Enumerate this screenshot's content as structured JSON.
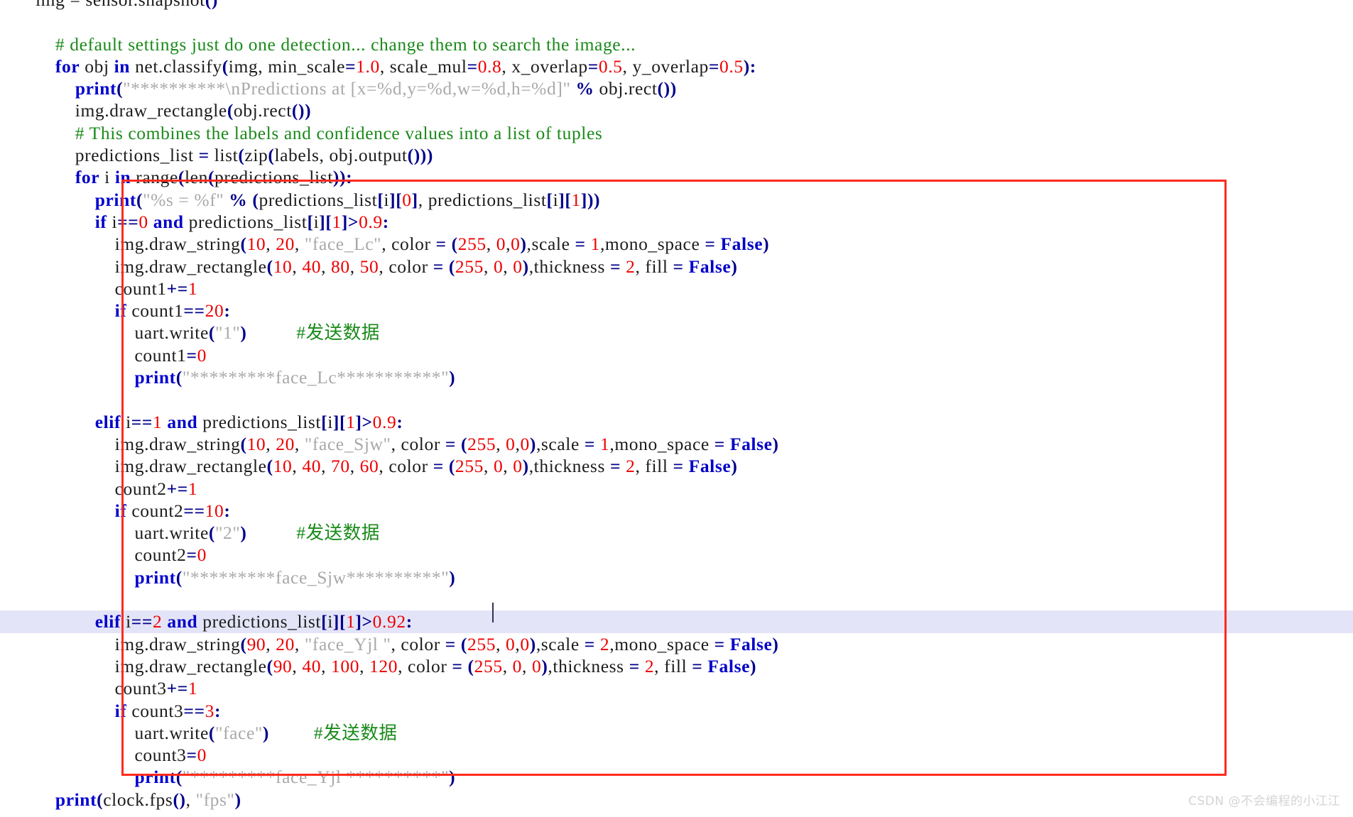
{
  "editor": {
    "language": "python",
    "background_color": "#ffffff",
    "highlight_color": "#e4e4f8",
    "annotation_box_color": "#ff2a1e",
    "caret_visible": true
  },
  "watermark": {
    "text": "CSDN @不会编程的小江江"
  },
  "colors": {
    "keyword": "#0000c8",
    "function": "#0000d2",
    "number": "#ee0000",
    "string": "#a9a9a9",
    "comment": "#1a8a1a",
    "punctuation": "#00008b",
    "plain": "#1c1c1c"
  },
  "code": {
    "lines": [
      {
        "id": 1,
        "highlight": false,
        "text": "img = sensor.snapshot()"
      },
      {
        "id": 2,
        "highlight": false,
        "text": ""
      },
      {
        "id": 3,
        "highlight": false,
        "text": "    # default settings just do one detection... change them to search the image..."
      },
      {
        "id": 4,
        "highlight": false,
        "text": "    for obj in net.classify(img, min_scale=1.0, scale_mul=0.8, x_overlap=0.5, y_overlap=0.5):"
      },
      {
        "id": 5,
        "highlight": false,
        "text": "        print(\"**********\\nPredictions at [x=%d,y=%d,w=%d,h=%d]\" % obj.rect())"
      },
      {
        "id": 6,
        "highlight": false,
        "text": "        img.draw_rectangle(obj.rect())"
      },
      {
        "id": 7,
        "highlight": false,
        "text": "        # This combines the labels and confidence values into a list of tuples"
      },
      {
        "id": 8,
        "highlight": false,
        "text": "        predictions_list = list(zip(labels, obj.output()))"
      },
      {
        "id": 9,
        "highlight": false,
        "text": "        for i in range(len(predictions_list)):"
      },
      {
        "id": 10,
        "highlight": false,
        "text": "            print(\"%s = %f\" % (predictions_list[i][0], predictions_list[i][1]))"
      },
      {
        "id": 11,
        "highlight": false,
        "text": "            if i==0 and predictions_list[i][1]>0.9:"
      },
      {
        "id": 12,
        "highlight": false,
        "text": "                img.draw_string(10, 20, \"face_Lc\", color = (255, 0,0),scale = 1,mono_space = False)"
      },
      {
        "id": 13,
        "highlight": false,
        "text": "                img.draw_rectangle(10, 40, 80, 50, color = (255, 0, 0),thickness = 2, fill = False)"
      },
      {
        "id": 14,
        "highlight": false,
        "text": "                count1+=1"
      },
      {
        "id": 15,
        "highlight": false,
        "text": "                if count1==20:"
      },
      {
        "id": 16,
        "highlight": false,
        "text": "                    uart.write(\"1\")          #发送数据"
      },
      {
        "id": 17,
        "highlight": false,
        "text": "                    count1=0"
      },
      {
        "id": 18,
        "highlight": false,
        "text": "                    print(\"*********face_Lc***********\")"
      },
      {
        "id": 19,
        "highlight": false,
        "text": ""
      },
      {
        "id": 20,
        "highlight": false,
        "text": "            elif i==1 and predictions_list[i][1]>0.9:"
      },
      {
        "id": 21,
        "highlight": false,
        "text": "                img.draw_string(10, 20, \"face_Sjw\", color = (255, 0,0),scale = 1,mono_space = False)"
      },
      {
        "id": 22,
        "highlight": false,
        "text": "                img.draw_rectangle(10, 40, 70, 60, color = (255, 0, 0),thickness = 2, fill = False)"
      },
      {
        "id": 23,
        "highlight": false,
        "text": "                count2+=1"
      },
      {
        "id": 24,
        "highlight": false,
        "text": "                if count2==10:"
      },
      {
        "id": 25,
        "highlight": false,
        "text": "                    uart.write(\"2\")          #发送数据"
      },
      {
        "id": 26,
        "highlight": false,
        "text": "                    count2=0"
      },
      {
        "id": 27,
        "highlight": false,
        "text": "                    print(\"*********face_Sjw**********\")"
      },
      {
        "id": 28,
        "highlight": false,
        "text": ""
      },
      {
        "id": 29,
        "highlight": true,
        "text": "            elif i==2 and predictions_list[i][1]>0.92:"
      },
      {
        "id": 30,
        "highlight": false,
        "text": "                img.draw_string(90, 20, \"face_Yjl \", color = (255, 0,0),scale = 2,mono_space = False)"
      },
      {
        "id": 31,
        "highlight": false,
        "text": "                img.draw_rectangle(90, 40, 100, 120, color = (255, 0, 0),thickness = 2, fill = False)"
      },
      {
        "id": 32,
        "highlight": false,
        "text": "                count3+=1"
      },
      {
        "id": 33,
        "highlight": false,
        "text": "                if count3==3:"
      },
      {
        "id": 34,
        "highlight": false,
        "text": "                    uart.write(\"face\")         #发送数据"
      },
      {
        "id": 35,
        "highlight": false,
        "text": "                    count3=0"
      },
      {
        "id": 36,
        "highlight": false,
        "text": "                    print(\"*********face_Yjl **********\")"
      },
      {
        "id": 37,
        "highlight": false,
        "text": "    print(clock.fps(), \"fps\")"
      }
    ]
  },
  "tokens": {
    "l1": [
      [
        "plain",
        "img = sensor.snapshot"
      ],
      [
        "punc",
        "()"
      ]
    ],
    "l3": [
      [
        "com",
        "    # default settings just do one detection... change them to search the image..."
      ]
    ],
    "l4": [
      [
        "plain",
        "    "
      ],
      [
        "kw",
        "for"
      ],
      [
        "plain",
        " obj "
      ],
      [
        "kw",
        "in"
      ],
      [
        "plain",
        " net.classify"
      ],
      [
        "punc",
        "("
      ],
      [
        "plain",
        "img, min_scale"
      ],
      [
        "op",
        "="
      ],
      [
        "num",
        "1.0"
      ],
      [
        "plain",
        ", scale_mul"
      ],
      [
        "op",
        "="
      ],
      [
        "num",
        "0.8"
      ],
      [
        "plain",
        ", x_overlap"
      ],
      [
        "op",
        "="
      ],
      [
        "num",
        "0.5"
      ],
      [
        "plain",
        ", y_overlap"
      ],
      [
        "op",
        "="
      ],
      [
        "num",
        "0.5"
      ],
      [
        "punc",
        "):"
      ]
    ],
    "l5": [
      [
        "plain",
        "        "
      ],
      [
        "fn",
        "print"
      ],
      [
        "punc",
        "("
      ],
      [
        "str",
        "\"**********\\nPredictions at [x=%d,y=%d,w=%d,h=%d]\""
      ],
      [
        "plain",
        " "
      ],
      [
        "op",
        "%"
      ],
      [
        "plain",
        " obj.rect"
      ],
      [
        "punc",
        "())"
      ]
    ],
    "l6": [
      [
        "plain",
        "        img.draw_rectangle"
      ],
      [
        "punc",
        "("
      ],
      [
        "plain",
        "obj.rect"
      ],
      [
        "punc",
        "())"
      ]
    ],
    "l7": [
      [
        "com",
        "        # This combines the labels and confidence values into a list of tuples"
      ]
    ],
    "l8": [
      [
        "plain",
        "        predictions_list "
      ],
      [
        "op",
        "="
      ],
      [
        "plain",
        " list"
      ],
      [
        "punc",
        "("
      ],
      [
        "plain",
        "zip"
      ],
      [
        "punc",
        "("
      ],
      [
        "plain",
        "labels, obj.output"
      ],
      [
        "punc",
        "()))"
      ]
    ],
    "l9": [
      [
        "plain",
        "        "
      ],
      [
        "kw",
        "for"
      ],
      [
        "plain",
        " i "
      ],
      [
        "kw",
        "in"
      ],
      [
        "plain",
        " range"
      ],
      [
        "punc",
        "("
      ],
      [
        "plain",
        "len"
      ],
      [
        "punc",
        "("
      ],
      [
        "plain",
        "predictions_list"
      ],
      [
        "punc",
        ")):"
      ]
    ],
    "l10": [
      [
        "plain",
        "            "
      ],
      [
        "fn",
        "print"
      ],
      [
        "punc",
        "("
      ],
      [
        "str",
        "\"%s = %f\""
      ],
      [
        "plain",
        " "
      ],
      [
        "op",
        "%"
      ],
      [
        "plain",
        " "
      ],
      [
        "punc",
        "("
      ],
      [
        "plain",
        "predictions_list"
      ],
      [
        "punc",
        "["
      ],
      [
        "plain",
        "i"
      ],
      [
        "punc",
        "]["
      ],
      [
        "num",
        "0"
      ],
      [
        "punc",
        "]"
      ],
      [
        "plain",
        ", predictions_list"
      ],
      [
        "punc",
        "["
      ],
      [
        "plain",
        "i"
      ],
      [
        "punc",
        "]["
      ],
      [
        "num",
        "1"
      ],
      [
        "punc",
        "]))"
      ]
    ],
    "l11": [
      [
        "plain",
        "            "
      ],
      [
        "kw",
        "if"
      ],
      [
        "plain",
        " i"
      ],
      [
        "op",
        "=="
      ],
      [
        "num",
        "0"
      ],
      [
        "plain",
        " "
      ],
      [
        "kw",
        "and"
      ],
      [
        "plain",
        " predictions_list"
      ],
      [
        "punc",
        "["
      ],
      [
        "plain",
        "i"
      ],
      [
        "punc",
        "]["
      ],
      [
        "num",
        "1"
      ],
      [
        "punc",
        "]"
      ],
      [
        "op",
        ">"
      ],
      [
        "num",
        "0.9"
      ],
      [
        "punc",
        ":"
      ]
    ],
    "l37": [
      [
        "plain",
        "    "
      ],
      [
        "fn",
        "print"
      ],
      [
        "punc",
        "("
      ],
      [
        "plain",
        "clock.fps"
      ],
      [
        "punc",
        "()"
      ],
      [
        "plain",
        ", "
      ],
      [
        "str",
        "\"fps\""
      ],
      [
        "punc",
        ")"
      ]
    ]
  }
}
